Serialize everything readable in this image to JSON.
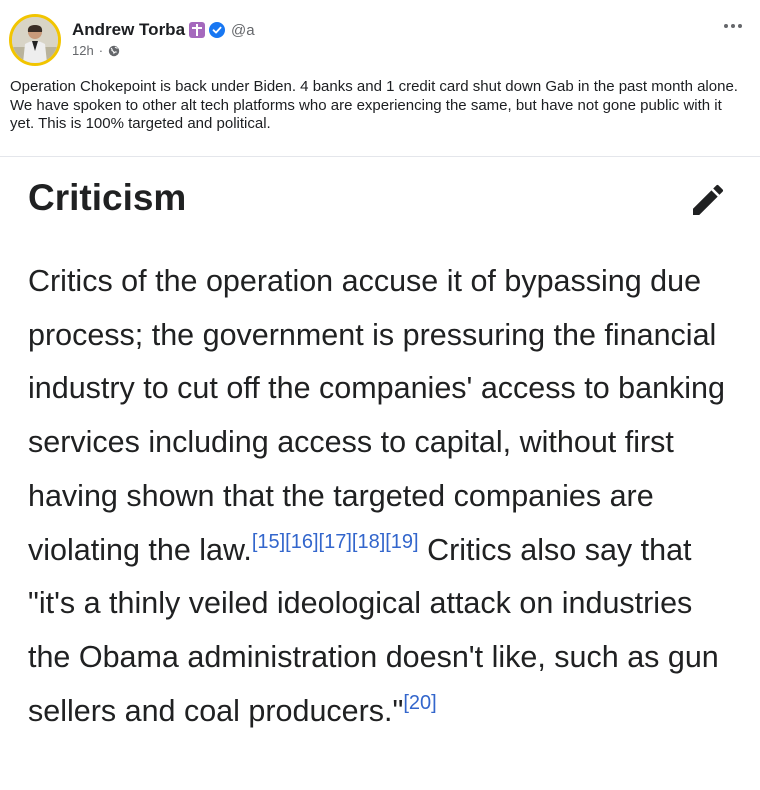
{
  "post": {
    "author_name": "Andrew Torba",
    "handle": "@a",
    "timestamp": "12h",
    "separator": "·",
    "visibility_icon": "globe-icon",
    "more_icon": "more-options-icon",
    "text": "Operation Chokepoint is back under Biden. 4 banks and 1 credit card shut down Gab in the past month alone. We have spoken to other alt tech platforms who are experiencing the same, but have not gone public with it yet. This is 100% targeted and political."
  },
  "article": {
    "heading": "Criticism",
    "edit_icon": "pencil-edit-icon",
    "paragraph_part1": "Critics of the operation accuse it of bypassing due process; the government is pressuring the financial industry to cut off the companies' access to banking services including access to capital, without first having shown that the targeted companies are violating the law.",
    "refs_group1": [
      "[15]",
      "[16]",
      "[17]",
      "[18]",
      "[19]"
    ],
    "paragraph_part2": " Critics also say that \"it's a thinly veiled ideological attack on industries the Obama administration doesn't like, such as gun sellers and coal producers.\"",
    "ref_final": "[20]"
  },
  "colors": {
    "link": "#3366cc",
    "badge_purple": "#a569bd",
    "verified_blue": "#1877f2",
    "secondary_text": "#65676b",
    "avatar_ring": "#f2c500"
  }
}
